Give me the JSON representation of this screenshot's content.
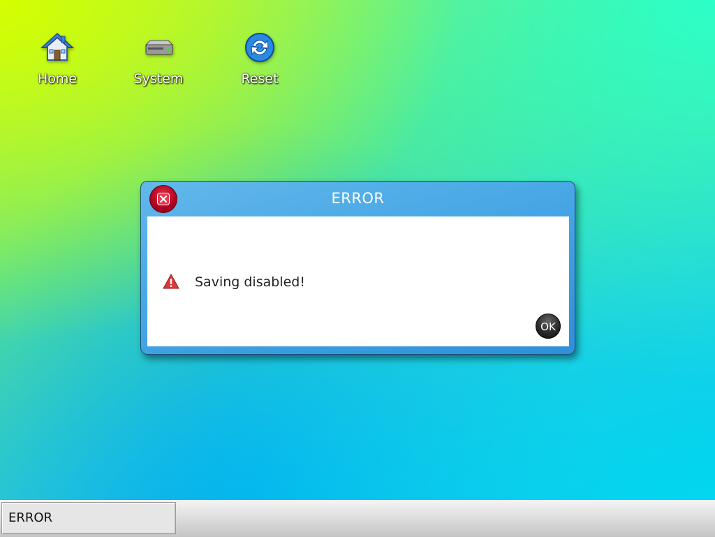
{
  "desktop": {
    "icons": [
      {
        "label": "Home",
        "icon": "home-icon"
      },
      {
        "label": "System",
        "icon": "drive-icon"
      },
      {
        "label": "Reset",
        "icon": "refresh-icon"
      }
    ]
  },
  "dialog": {
    "title": "ERROR",
    "message": "Saving disabled!",
    "ok_label": "OK",
    "title_icon": "close-icon",
    "message_icon": "warning-icon"
  },
  "taskbar": {
    "items": [
      {
        "label": "ERROR"
      }
    ]
  },
  "colors": {
    "dialog_frame": "#4aa8e6",
    "close_button": "#b00020",
    "warning": "#d83a3a"
  }
}
